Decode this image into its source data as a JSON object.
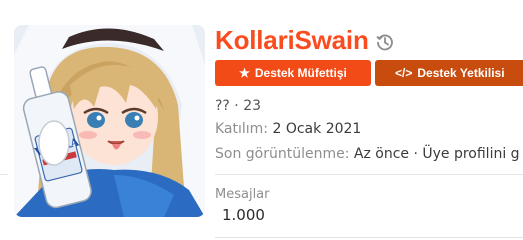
{
  "profile": {
    "username": "KollariSwain",
    "badges": [
      {
        "label": "Destek Müfettişi",
        "icon": "star-icon"
      },
      {
        "label": "Destek Yetkilisi",
        "icon": "code-icon"
      }
    ],
    "age_line": "?? · 23",
    "joined_label": "Katılım:",
    "joined_value": "2 Ocak 2021",
    "seen_label": "Son görüntülenme:",
    "seen_value": "Az önce · Üye profilini g",
    "avatar_text": "VODKA"
  },
  "stats": {
    "messages_label": "Mesajlar",
    "messages_value": "1.000"
  },
  "colors": {
    "username": "#fa4c1e",
    "badge_primary": "#f24b18",
    "badge_secondary": "#c94c0f"
  }
}
